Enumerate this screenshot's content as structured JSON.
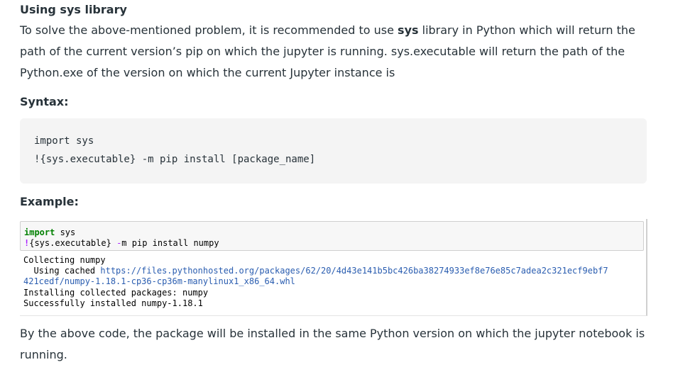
{
  "article": {
    "heading": "Using sys library",
    "intro": {
      "part1": "To solve the above-mentioned problem, it is recommended to use ",
      "bold": "sys",
      "part2": " library in Python which will return the path of the current version’s pip on which the jupyter is running. sys.executable will return the path of the Python.exe of the version on which the current Jupyter instance is"
    },
    "syntax_label": "Syntax:",
    "syntax_lines": [
      "import sys",
      "!{sys.executable} -m pip install [package_name]"
    ],
    "example_label": "Example:",
    "notebook": {
      "input": {
        "line1_kw": "import",
        "line1_rest": " sys",
        "line2_bang": "!",
        "line2_rest": "{sys.executable} ",
        "line2_op": "-",
        "line2_tail": "m pip install numpy"
      },
      "output": {
        "line1": "Collecting numpy",
        "line2_prefix": "  Using cached ",
        "line2_link": "https://files.pythonhosted.org/packages/62/20/4d43e141b5bc426ba38274933ef8e76e85c7adea2c321ecf9ebf7",
        "line3_link": "421cedf/numpy-1.18.1-cp36-cp36m-manylinux1_x86_64.whl",
        "line4": "Installing collected packages: numpy",
        "line5": "Successfully installed numpy-1.18.1"
      }
    },
    "conclusion": "By the above code, the package will be installed in the same Python version on which the jupyter notebook is running."
  },
  "colors": {
    "text": "#273239",
    "code_bg": "#f4f4f4",
    "keyword": "#008000",
    "magic": "#aa22ff",
    "link": "#2a5db0"
  }
}
